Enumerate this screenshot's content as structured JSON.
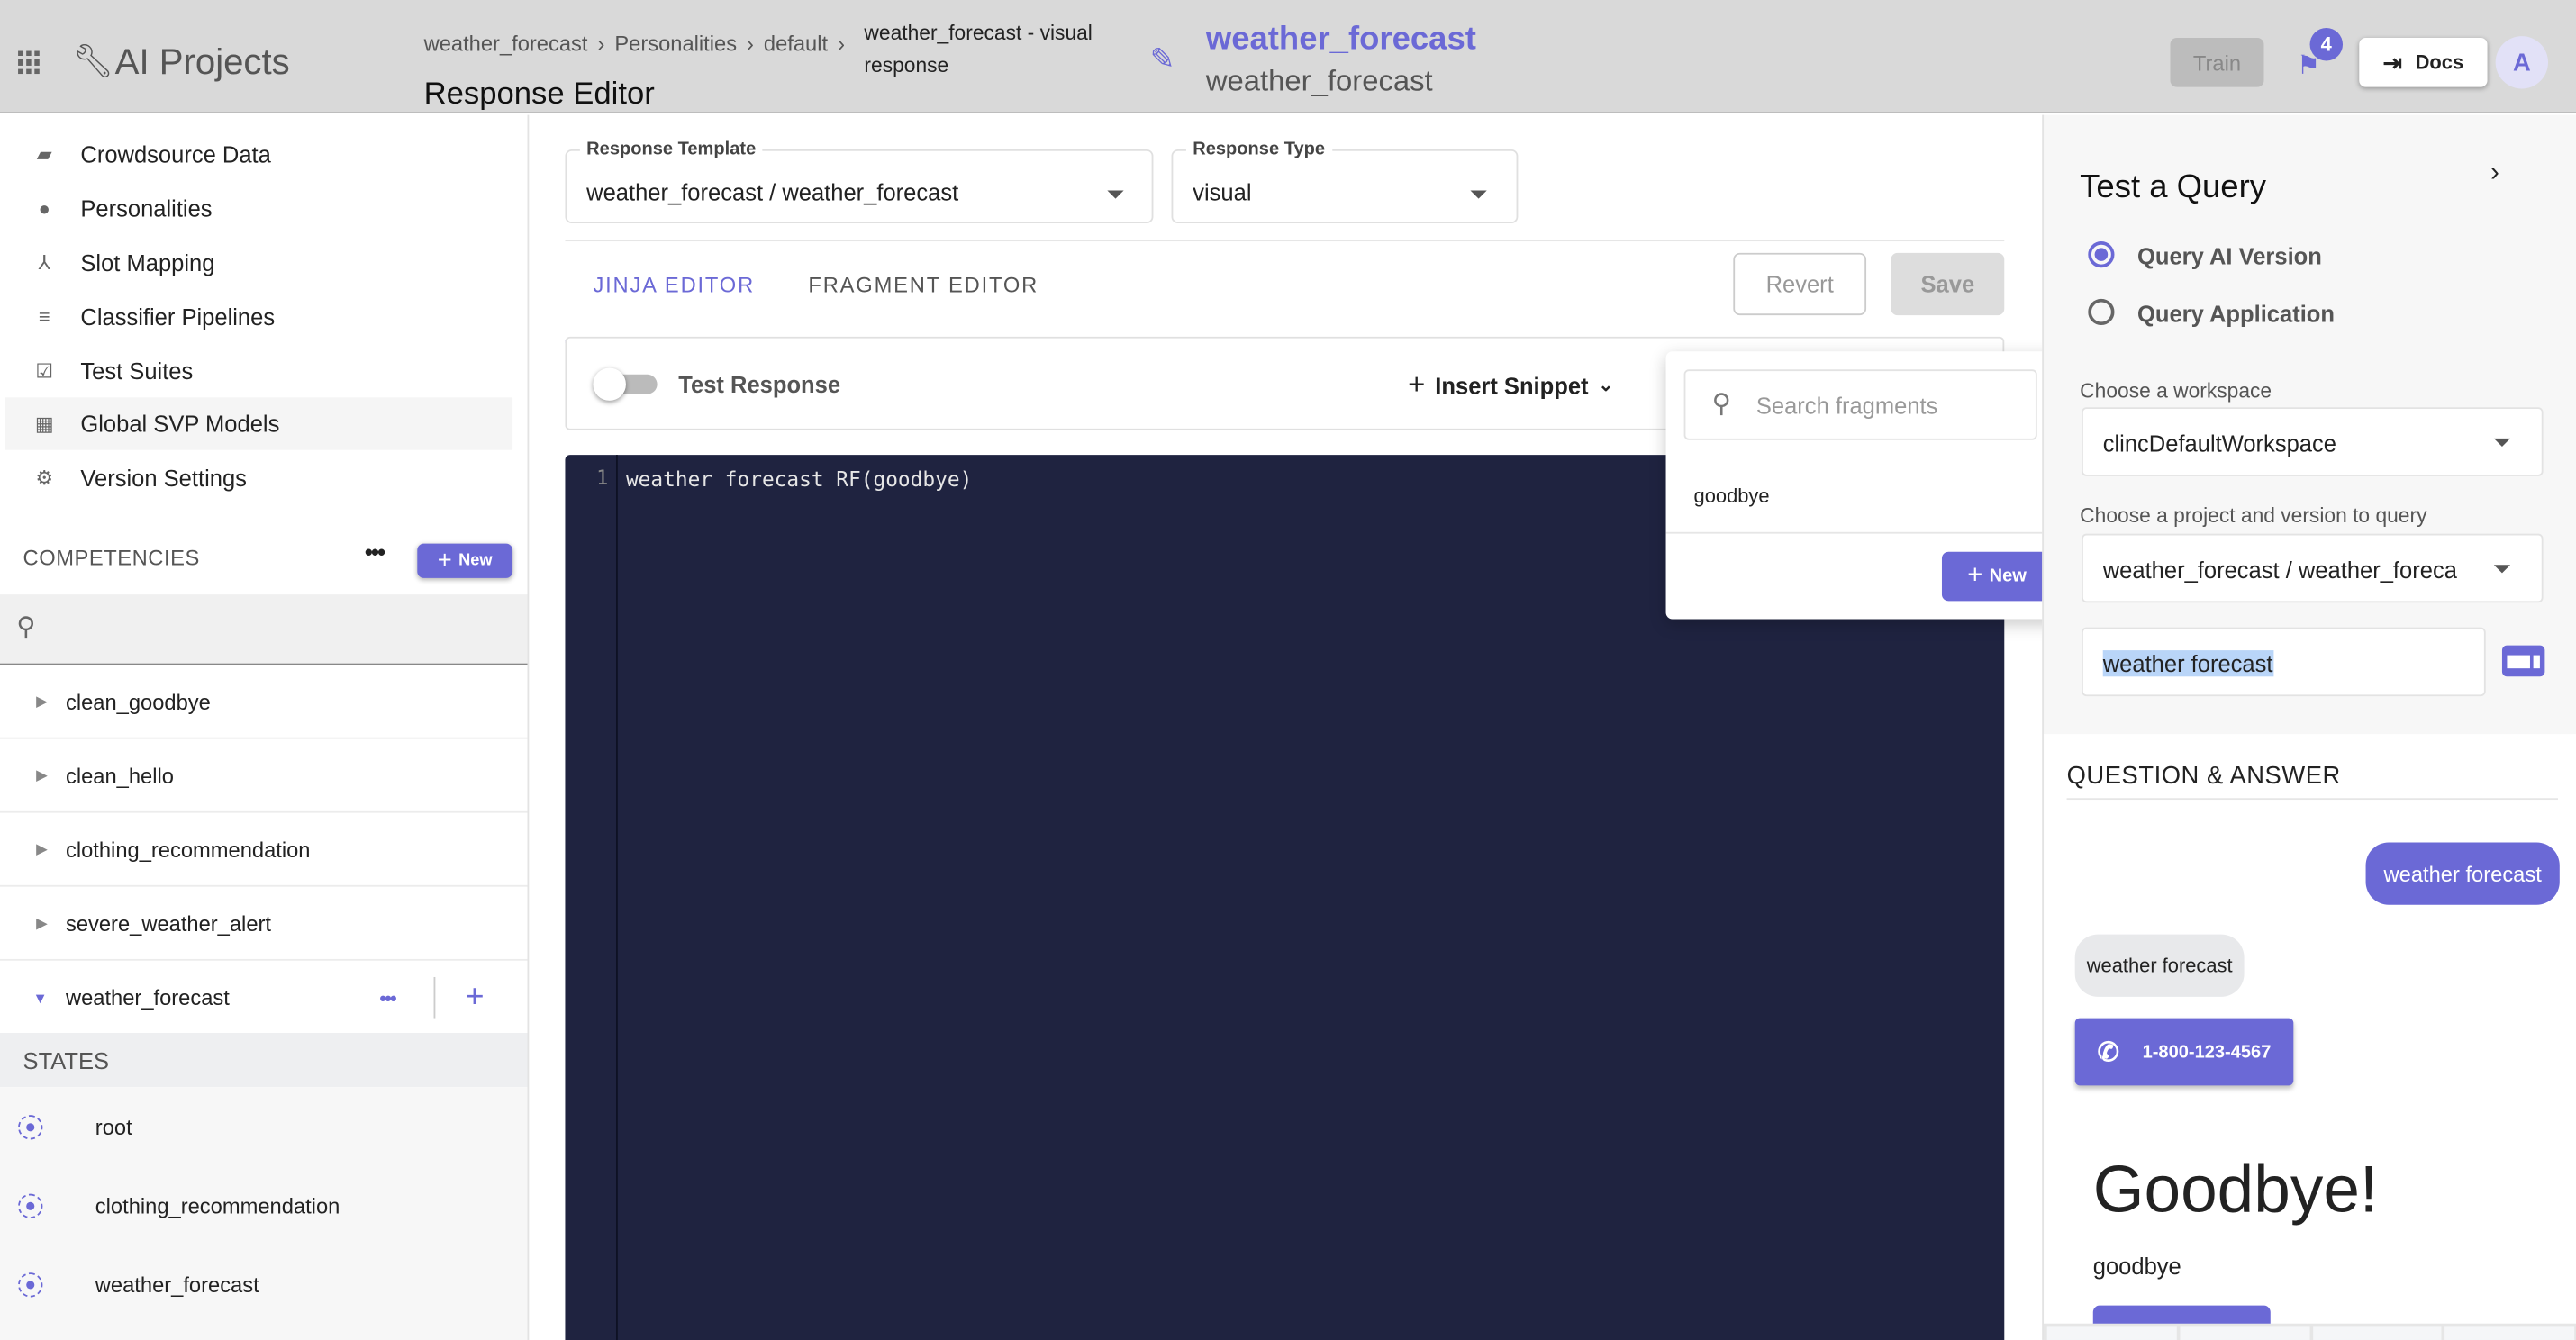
{
  "header": {
    "app_title": "AI Projects",
    "breadcrumb": [
      "weather_forecast",
      "Personalities",
      "default"
    ],
    "breadcrumb_current_line1": "weather_forecast - visual",
    "breadcrumb_current_line2": "response",
    "page_title": "Response Editor",
    "project_title": "weather_forecast",
    "project_subtitle": "weather_forecast",
    "train_label": "Train",
    "notification_count": "4",
    "docs_label": "Docs",
    "avatar_initial": "A"
  },
  "sidebar": {
    "nav": [
      {
        "label": "Crowdsource Data",
        "icon": "forum-icon"
      },
      {
        "label": "Personalities",
        "icon": "person-icon"
      },
      {
        "label": "Slot Mapping",
        "icon": "merge-icon"
      },
      {
        "label": "Classifier Pipelines",
        "icon": "lines-icon"
      },
      {
        "label": "Test Suites",
        "icon": "clipboard-check-icon"
      },
      {
        "label": "Global SVP Models",
        "icon": "dashboard-icon",
        "active": true
      },
      {
        "label": "Version Settings",
        "icon": "gear-icon"
      }
    ],
    "competencies_label": "COMPETENCIES",
    "new_label": "New",
    "competencies": [
      "clean_goodbye",
      "clean_hello",
      "clothing_recommendation",
      "severe_weather_alert",
      "weather_forecast"
    ],
    "states_label": "STATES",
    "states": [
      "root",
      "clothing_recommendation",
      "weather_forecast"
    ]
  },
  "main": {
    "response_template_label": "Response Template",
    "response_template_value": "weather_forecast / weather_forecast",
    "response_type_label": "Response Type",
    "response_type_value": "visual",
    "tabs": [
      {
        "label": "JINJA EDITOR",
        "active": true
      },
      {
        "label": "FRAGMENT EDITOR"
      }
    ],
    "revert_label": "Revert",
    "save_label": "Save",
    "test_response_label": "Test Response",
    "test_response_on": false,
    "insert_snippet_label": "Insert Snippet",
    "code_line_number": "1",
    "code": "weather forecast RF(goodbye)",
    "popup": {
      "search_placeholder": "Search fragments",
      "items": [
        "goodbye"
      ],
      "new_label": "New"
    }
  },
  "test_panel": {
    "title": "Test a Query",
    "radio_options": [
      {
        "label": "Query AI Version",
        "selected": true
      },
      {
        "label": "Query Application",
        "selected": false
      }
    ],
    "workspace_label": "Choose a workspace",
    "workspace_value": "clincDefaultWorkspace",
    "project_label": "Choose a project and version to query",
    "project_value": "weather_forecast / weather_forecast",
    "query_value": "weather forecast",
    "qa_label": "QUESTION & ANSWER",
    "user_message": "weather forecast",
    "bot_message": "weather forecast",
    "phone_button": "1-800-123-4567",
    "goodbye_heading": "Goodbye!",
    "goodbye_text": "goodbye"
  },
  "colors": {
    "accent": "#6b69d6",
    "header_bg": "#d9d9d9",
    "editor_bg": "#1f2340"
  }
}
